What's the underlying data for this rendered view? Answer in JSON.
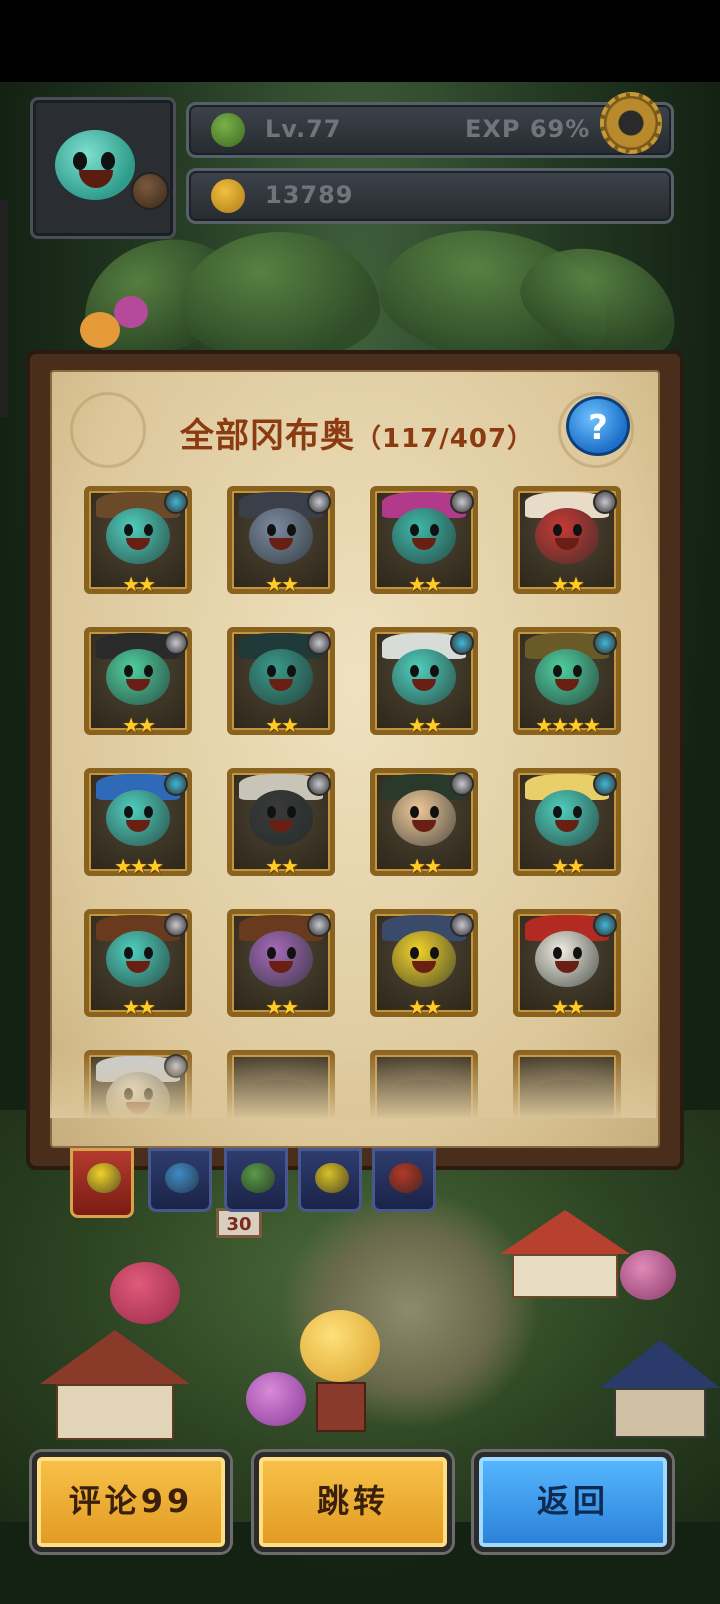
{
  "hud": {
    "level": "Lv.77",
    "exp": "EXP 69%",
    "coins": "13789"
  },
  "panel": {
    "title": "全部冈布奥",
    "count": "（117/407）",
    "help_label": "?"
  },
  "cards": [
    {
      "stars": "★★",
      "body": "#4fcfbd",
      "hat": "#6b4a2a",
      "badge": "#3fb8d8",
      "unlocked": true
    },
    {
      "stars": "★★",
      "body": "#7d8aa0",
      "hat": "#3b3f4a",
      "badge": "#c8c8d0",
      "unlocked": true
    },
    {
      "stars": "★★",
      "body": "#3fb8a8",
      "hat": "#b23a8a",
      "badge": "#c8c8d0",
      "unlocked": true
    },
    {
      "stars": "★★",
      "body": "#c83a34",
      "hat": "#e8dcc8",
      "badge": "#c8c8d0",
      "unlocked": true
    },
    {
      "stars": "★★",
      "body": "#4fcfa0",
      "hat": "#2a2a2a",
      "badge": "#c8c8d0",
      "unlocked": true
    },
    {
      "stars": "★★",
      "body": "#3a9a8a",
      "hat": "#1f3a38",
      "badge": "#c8c8d0",
      "unlocked": true
    },
    {
      "stars": "★★",
      "body": "#4fcfbd",
      "hat": "#d8dcd8",
      "badge": "#3fb8d8",
      "unlocked": true
    },
    {
      "stars": "★★★★",
      "body": "#4fcfa0",
      "hat": "#6a5a28",
      "badge": "#3fb8d8",
      "unlocked": true
    },
    {
      "stars": "★★★",
      "body": "#4fcfbd",
      "hat": "#2f6ab8",
      "badge": "#3fb8d8",
      "unlocked": true
    },
    {
      "stars": "★★",
      "body": "#3a3a3a",
      "hat": "#c8c4b8",
      "badge": "#c8c8d0",
      "unlocked": true
    },
    {
      "stars": "★★",
      "body": "#f0c89a",
      "hat": "#2a3a2a",
      "badge": "#c8c8d0",
      "unlocked": true
    },
    {
      "stars": "★★",
      "body": "#4fcfbd",
      "hat": "#e8cf6a",
      "badge": "#3fb8d8",
      "unlocked": true
    },
    {
      "stars": "★★",
      "body": "#4fcfbd",
      "hat": "#6a3a1f",
      "badge": "#c8c8d0",
      "unlocked": true
    },
    {
      "stars": "★★",
      "body": "#a56ab8",
      "hat": "#6a3a1f",
      "badge": "#c8c8d0",
      "unlocked": true
    },
    {
      "stars": "★★",
      "body": "#f2d12a",
      "hat": "#3a4a6a",
      "badge": "#c8c8d0",
      "unlocked": true
    },
    {
      "stars": "★★",
      "body": "#f0ece0",
      "hat": "#b22a22",
      "badge": "#3fb8d8",
      "unlocked": true
    },
    {
      "stars": "",
      "body": "#f0e6d8",
      "hat": "#c8ccd0",
      "badge": "#c8c8d0",
      "unlocked": true
    },
    {
      "stars": "",
      "body": "#3c3426",
      "hat": "#3c3426",
      "badge": "",
      "unlocked": false
    },
    {
      "stars": "",
      "body": "#3c3426",
      "hat": "#3c3426",
      "badge": "",
      "unlocked": false
    },
    {
      "stars": "",
      "body": "#3c3426",
      "hat": "#3c3426",
      "badge": "",
      "unlocked": false
    }
  ],
  "tabs": [
    {
      "name": "tab-all",
      "color": "#f2d12a",
      "active": true
    },
    {
      "name": "tab-blue",
      "color": "#3f8ac8",
      "active": false
    },
    {
      "name": "tab-green",
      "color": "#5a9a4a",
      "active": false
    },
    {
      "name": "tab-yellow",
      "color": "#d8c02a",
      "active": false
    },
    {
      "name": "tab-red",
      "color": "#b23a2a",
      "active": false
    }
  ],
  "village": {
    "sign": "30"
  },
  "buttons": {
    "comment": "评论99",
    "jump": "跳转",
    "back": "返回"
  },
  "colors": {
    "gold_button": "#f2b53a",
    "blue_button": "#3e9ef0",
    "title_text": "#8b3a12",
    "star": "#ffcc2a"
  }
}
